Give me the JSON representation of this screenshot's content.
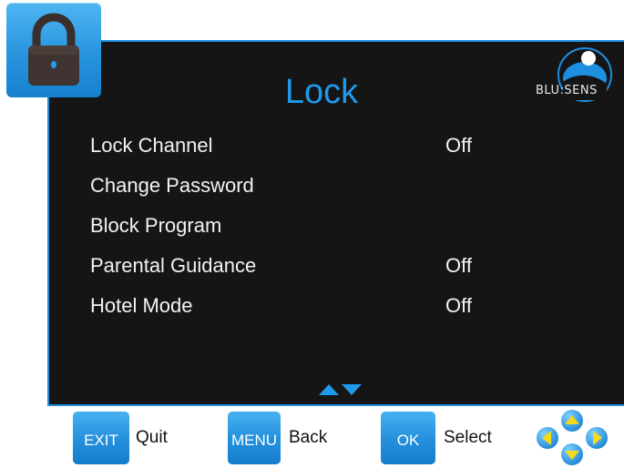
{
  "colors": {
    "panel_background": "#151515",
    "accent_blue": "#1f9aeb",
    "button_blue": "#238fdc",
    "text_light": "#f2f2f2",
    "nav_yellow": "#f5d91a"
  },
  "header": {
    "title": "Lock",
    "brand_text": "BLU:SENS",
    "lock_icon": "padlock-icon"
  },
  "menu": {
    "items": [
      {
        "label": "Lock Channel",
        "value": "Off"
      },
      {
        "label": "Change Password",
        "value": ""
      },
      {
        "label": "Block Program",
        "value": ""
      },
      {
        "label": "Parental Guidance",
        "value": "Off"
      },
      {
        "label": "Hotel Mode",
        "value": "Off"
      }
    ],
    "scroll_icon": "up-down-arrows-icon"
  },
  "hints": {
    "exit_key": "EXIT",
    "exit_action": "Quit",
    "menu_key": "MENU",
    "menu_action": "Back",
    "ok_key": "OK",
    "ok_action": "Select",
    "nav_icon": "direction-pad-icon"
  }
}
